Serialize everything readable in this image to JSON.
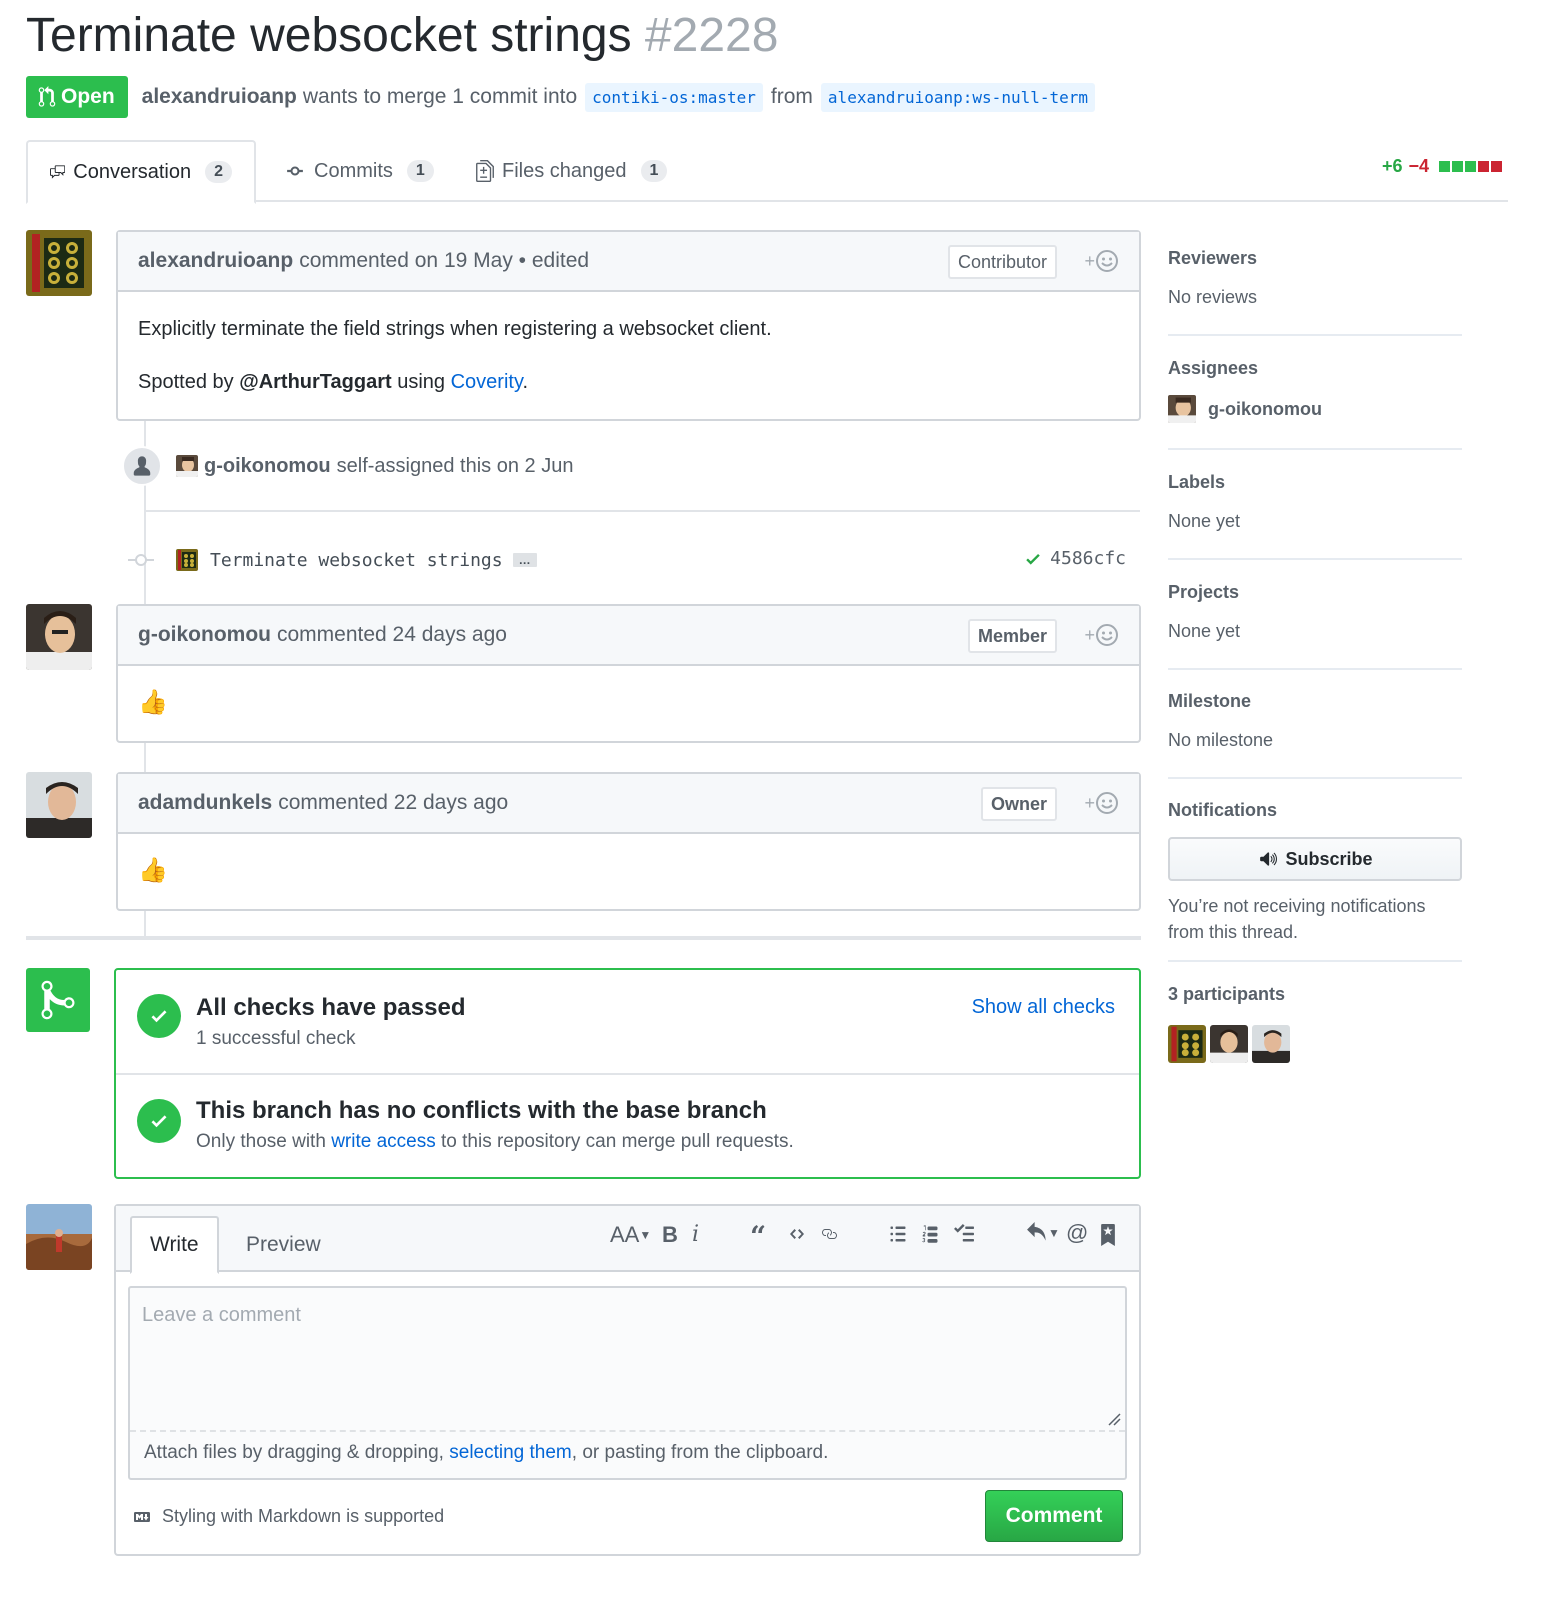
{
  "pr": {
    "title": "Terminate websocket strings",
    "number": "#2228",
    "state": "Open",
    "author": "alexandruioanp",
    "merge_text": "wants to merge 1 commit into",
    "base_branch": "contiki-os:master",
    "from_text": "from",
    "head_branch": "alexandruioanp:ws-null-term"
  },
  "tabs": [
    {
      "label": "Conversation",
      "count": "2"
    },
    {
      "label": "Commits",
      "count": "1"
    },
    {
      "label": "Files changed",
      "count": "1"
    }
  ],
  "diffstat": {
    "additions": "+6",
    "deletions": "−4"
  },
  "comments": [
    {
      "author": "alexandruioanp",
      "meta": "commented on 19 May • edited",
      "role": "Contributor",
      "body_line1": "Explicitly terminate the field strings when registering a websocket client.",
      "spotted_prefix": "Spotted by",
      "spotted_mention": "@ArthurTaggart",
      "spotted_mid": "using",
      "spotted_link": "Coverity",
      "spotted_end": "."
    },
    {
      "author": "g-oikonomou",
      "meta": "commented 24 days ago",
      "role": "Member",
      "body": "👍"
    },
    {
      "author": "adamdunkels",
      "meta": "commented 22 days ago",
      "role": "Owner",
      "body": "👍"
    }
  ],
  "events": {
    "assign_user": "g-oikonomou",
    "assign_text": "self-assigned this on 2 Jun",
    "commit_message": "Terminate websocket strings",
    "commit_ellipsis": "…",
    "commit_sha": "4586cfc"
  },
  "merge": {
    "checks_title": "All checks have passed",
    "checks_sub": "1 successful check",
    "show_checks": "Show all checks",
    "conflict_title": "This branch has no conflicts with the base branch",
    "conflict_sub_prefix": "Only those with",
    "conflict_sub_link": "write access",
    "conflict_sub_suffix": "to this repository can merge pull requests."
  },
  "editor": {
    "tab_write": "Write",
    "tab_preview": "Preview",
    "placeholder": "Leave a comment",
    "attach_prefix": "Attach files by dragging & dropping,",
    "attach_link": "selecting them",
    "attach_suffix": ", or pasting from the clipboard.",
    "markdown_note": "Styling with Markdown is supported",
    "submit_label": "Comment",
    "toolbar_icons": [
      "text-size-icon",
      "bold-icon",
      "italic-icon",
      "quote-icon",
      "code-icon",
      "link-icon",
      "bullet-list-icon",
      "numbered-list-icon",
      "task-list-icon",
      "reply-icon",
      "mention-icon",
      "bookmark-icon"
    ]
  },
  "sidebar": {
    "reviewers": {
      "heading": "Reviewers",
      "value": "No reviews"
    },
    "assignees": {
      "heading": "Assignees",
      "value": "g-oikonomou"
    },
    "labels": {
      "heading": "Labels",
      "value": "None yet"
    },
    "projects": {
      "heading": "Projects",
      "value": "None yet"
    },
    "milestone": {
      "heading": "Milestone",
      "value": "No milestone"
    },
    "notifications": {
      "heading": "Notifications",
      "button": "Subscribe",
      "note": "You’re not receiving notifications from this thread."
    },
    "participants": {
      "heading": "3 participants"
    }
  },
  "colors": {
    "accent": "#2cbe4e",
    "link": "#0366d6",
    "deletion": "#cb2431",
    "muted": "#586069"
  }
}
